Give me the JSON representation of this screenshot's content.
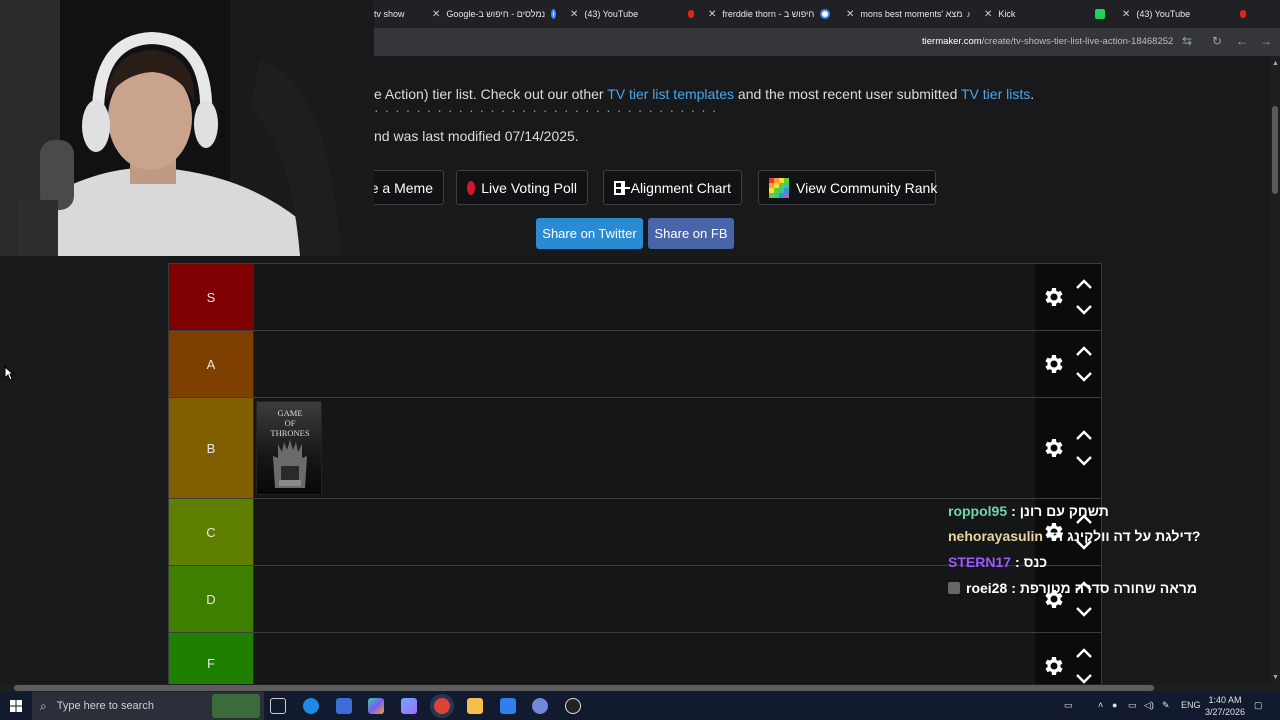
{
  "browser": {
    "tabs": [
      {
        "title": "tv show",
        "icon": "close-icon"
      },
      {
        "title": "Google-נמלסים - חיפוש ב",
        "icon": "google-icon"
      },
      {
        "title": "(43) YouTube",
        "icon": "youtube-icon"
      },
      {
        "title": "frerddie thorn - חיפוש ב",
        "icon": "google-icon"
      },
      {
        "title": "mons best moments' מצא",
        "icon": "tiktok-icon"
      },
      {
        "title": "Kick",
        "icon": "kick-icon"
      },
      {
        "title": "(43) YouTube",
        "icon": "youtube-icon"
      }
    ],
    "url_domain": "tiermaker.com",
    "url_path": "/create/tv-shows-tier-list-live-action-18468252"
  },
  "page": {
    "line1_prefix": "e Action) tier list. Check out our other ",
    "line1_link1": "TV tier list templates",
    "line1_mid": " and the most recent user submitted ",
    "line1_link2": "TV tier lists",
    "line1_suffix": ".",
    "line2": "nd was last modified 07/14/2025.",
    "buttons": {
      "meme": "te a Meme",
      "voting": "Live Voting Poll",
      "alignment": "Alignment Chart",
      "community": "View Community Rank"
    },
    "share_twitter": "Share on Twitter",
    "share_fb": "Share on FB"
  },
  "tiers": [
    {
      "label": "S",
      "color": "#7f0000"
    },
    {
      "label": "A",
      "color": "#7f3f00"
    },
    {
      "label": "B",
      "color": "#7f5f00"
    },
    {
      "label": "C",
      "color": "#5f7f00"
    },
    {
      "label": "D",
      "color": "#3f7f00"
    },
    {
      "label": "F",
      "color": "#1f7f00"
    }
  ],
  "tier_items": {
    "B": [
      {
        "title": "Game of Thrones",
        "poster_text_1": "GAME",
        "poster_text_2": "OF",
        "poster_text_3": "THRONES"
      }
    ]
  },
  "chat": [
    {
      "user": "roppol95",
      "color": "#6fd6a8",
      "message": ": תשחק עם רונן"
    },
    {
      "user": "nehorayasulin",
      "color": "#e8d5a0",
      "message": "דילגת על דה וולקינג דד?"
    },
    {
      "user": "STERN17",
      "color": "#9b59ff",
      "message": ": כנס"
    },
    {
      "user": "roei28",
      "color": "#ffffff",
      "message": ": מראה שחורה סדרה מטורפת"
    }
  ],
  "taskbar": {
    "search_placeholder": "Type here to search",
    "language": "ENG",
    "time": "1:40 AM",
    "date": "3/27/2026"
  }
}
